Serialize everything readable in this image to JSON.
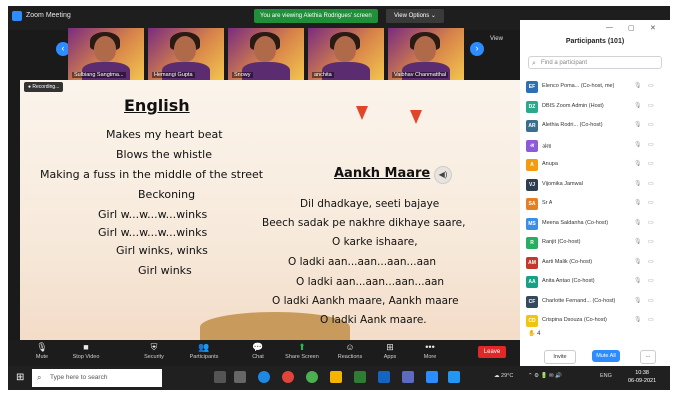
{
  "window": {
    "title": "Zoom Meeting"
  },
  "banner": {
    "sharing": "You are viewing Alethia Rodrigues' screen",
    "view_options": "View Options ⌄",
    "view": "View"
  },
  "thumbnails": [
    {
      "name": "Sulbiang Sangtma..."
    },
    {
      "name": "Hemangi Gupta"
    },
    {
      "name": "Snowy"
    },
    {
      "name": "anchita"
    },
    {
      "name": "Vaibhav Chanmatthal"
    }
  ],
  "recording": "● Recording...",
  "slide": {
    "english_heading": "English",
    "english_lines": [
      "Makes my heart beat",
      "Blows the whistle",
      "Making a fuss in the middle of the street",
      "Beckoning",
      "Girl w...w...w...winks",
      "Girl w...w...w...winks",
      "Girl winks, winks",
      "Girl winks"
    ],
    "hindi_heading": "Aankh Maare",
    "hindi_lines": [
      "Dil dhadkaye, seeti bajaye",
      "Beech sadak pe nakhre dikhaye saare,",
      "O karke ishaare,",
      "O ladki aan...aan...aan...aan",
      "O ladki aan...aan...aan...aan",
      "O ladki Aankh maare, Aankh maare",
      "O ladki Aank maare."
    ]
  },
  "toolbar": {
    "mute": "Mute",
    "stop_video": "Stop Video",
    "security": "Security",
    "participants": "Participants",
    "participants_count": "101",
    "chat": "Chat",
    "share_screen": "Share Screen",
    "reactions": "Reactions",
    "apps": "Apps",
    "more": "More",
    "leave": "Leave"
  },
  "panel": {
    "title": "Participants (101)",
    "search_placeholder": "Find a participant",
    "hand_count": "4",
    "invite": "Invite",
    "mute_all": "Mute All",
    "more": "..."
  },
  "participants": [
    {
      "initials": "EF",
      "color": "#2d6fb3",
      "name": "Elenco Poma... (Co-host, me)"
    },
    {
      "initials": "DZ",
      "color": "#2aa98c",
      "name": "DBIS Zoom Admin (Host)"
    },
    {
      "initials": "AR",
      "color": "#3c6e8f",
      "name": "Alethia Rodri... (Co-host)"
    },
    {
      "initials": "अ",
      "color": "#8d5ad8",
      "name": "अंशा"
    },
    {
      "initials": "A",
      "color": "#f39c12",
      "name": "Anupa"
    },
    {
      "initials": "VJ",
      "color": "#2c3e50",
      "name": "Vijomika Jamwal"
    },
    {
      "initials": "SA",
      "color": "#e67e22",
      "name": "Sr A"
    },
    {
      "initials": "MS",
      "color": "#3a8ee6",
      "name": "Meena Saldanha (Co-host)"
    },
    {
      "initials": "R",
      "color": "#27ae60",
      "name": "Ranjit (Co-host)"
    },
    {
      "initials": "AM",
      "color": "#c0392b",
      "name": "Aarti Malik (Co-host)"
    },
    {
      "initials": "AA",
      "color": "#16a085",
      "name": "Anita Antao (Co-host)"
    },
    {
      "initials": "CF",
      "color": "#34495e",
      "name": "Charlotte Fernand... (Co-host)"
    },
    {
      "initials": "CD",
      "color": "#f1c40f",
      "name": "Crispina Dsouza (Co-host)"
    }
  ],
  "taskbar": {
    "search_placeholder": "Type here to search",
    "weather": "29°C",
    "lang": "ENG",
    "time": "10:38",
    "date": "06-09-2021"
  },
  "colors": {
    "zoom_blue": "#2d8cff",
    "leave_red": "#e02828",
    "share_green": "#1f8f3a"
  }
}
